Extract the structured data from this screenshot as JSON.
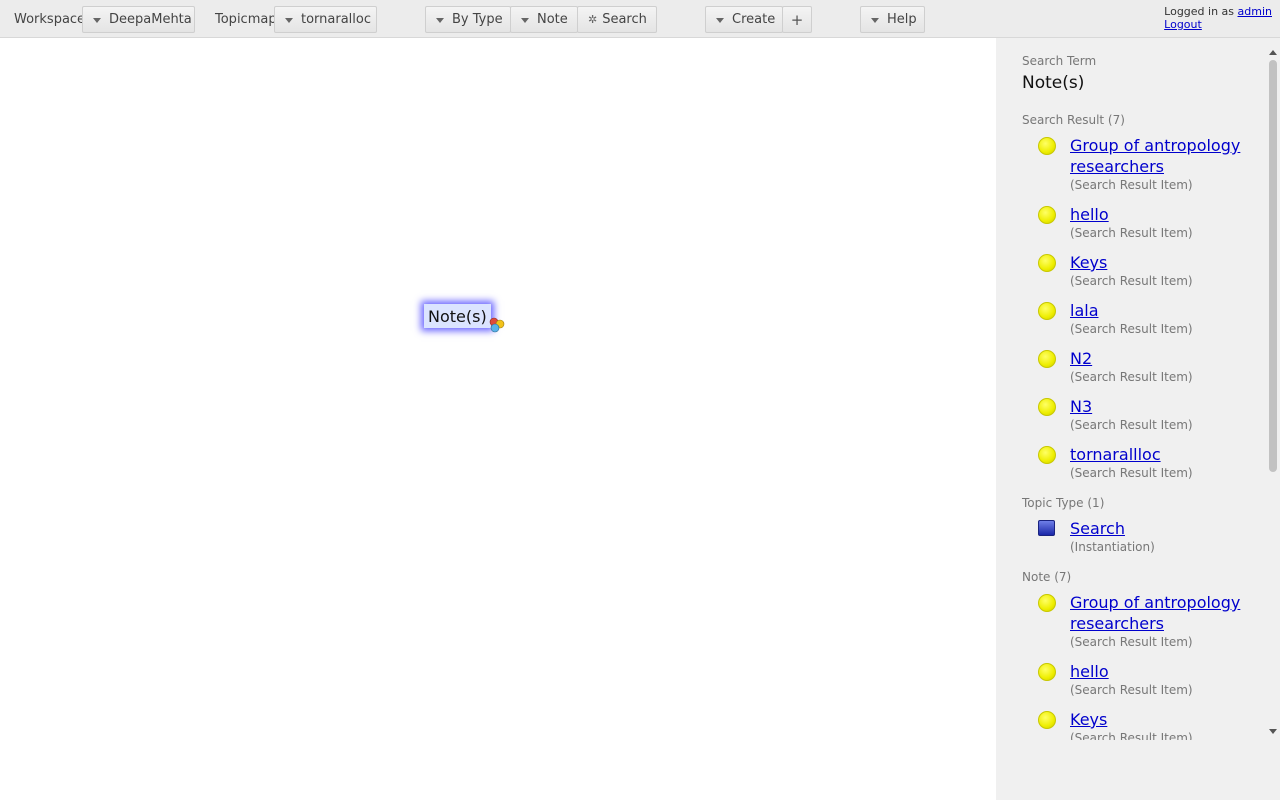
{
  "toolbar": {
    "workspace_label": "Workspace",
    "workspace_value": "DeepaMehta",
    "topicmap_label": "Topicmap",
    "topicmap_value": "tornaralloc",
    "by_type": "By Type",
    "note": "Note",
    "search": "Search",
    "create": "Create",
    "add": "+",
    "help": "Help"
  },
  "login": {
    "prefix": "Logged in as",
    "user": "admin",
    "logout": "Logout"
  },
  "canvas": {
    "topic_label": "Note(s)"
  },
  "detail": {
    "search_term_label": "Search Term",
    "search_term_value": "Note(s)",
    "groups": [
      {
        "label": "Search Result (7)",
        "icon": "yellow-dot",
        "items": [
          {
            "title": "Group of antropology researchers",
            "sub": "(Search Result Item)"
          },
          {
            "title": "hello",
            "sub": "(Search Result Item)"
          },
          {
            "title": "Keys",
            "sub": "(Search Result Item)"
          },
          {
            "title": "lala",
            "sub": "(Search Result Item)"
          },
          {
            "title": "N2",
            "sub": "(Search Result Item)"
          },
          {
            "title": "N3",
            "sub": "(Search Result Item)"
          },
          {
            "title": "tornarallloc",
            "sub": "(Search Result Item)"
          }
        ]
      },
      {
        "label": "Topic Type (1)",
        "icon": "blue-square",
        "items": [
          {
            "title": "Search",
            "sub": "(Instantiation)"
          }
        ]
      },
      {
        "label": "Note (7)",
        "icon": "yellow-dot",
        "items": [
          {
            "title": "Group of antropology researchers",
            "sub": "(Search Result Item)"
          },
          {
            "title": "hello",
            "sub": "(Search Result Item)"
          },
          {
            "title": "Keys",
            "sub": "(Search Result Item)"
          }
        ]
      }
    ]
  },
  "colors": {
    "link": "#0000cc",
    "topic_glow": "#6b66ff",
    "topic_bg": "#dbe4ff",
    "note_icon": "#eeee00",
    "type_icon": "#1a27a8"
  }
}
